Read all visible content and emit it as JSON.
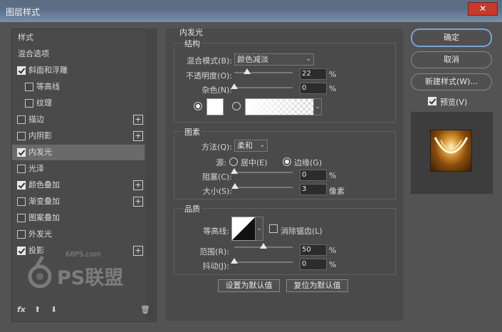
{
  "window": {
    "title": "图层样式",
    "close_icon": "close-icon"
  },
  "sidebar": {
    "items": [
      {
        "label": "样式",
        "checkbox": false,
        "checked": false,
        "plus": false,
        "selected": false,
        "indent": false
      },
      {
        "label": "混合选项",
        "checkbox": false,
        "checked": false,
        "plus": false,
        "selected": false,
        "indent": false
      },
      {
        "label": "斜面和浮雕",
        "checkbox": true,
        "checked": true,
        "plus": false,
        "selected": false,
        "indent": false
      },
      {
        "label": "等高线",
        "checkbox": true,
        "checked": false,
        "plus": false,
        "selected": false,
        "indent": true
      },
      {
        "label": "纹理",
        "checkbox": true,
        "checked": false,
        "plus": false,
        "selected": false,
        "indent": true
      },
      {
        "label": "描边",
        "checkbox": true,
        "checked": false,
        "plus": true,
        "selected": false,
        "indent": false
      },
      {
        "label": "内阴影",
        "checkbox": true,
        "checked": false,
        "plus": true,
        "selected": false,
        "indent": false
      },
      {
        "label": "内发光",
        "checkbox": true,
        "checked": true,
        "plus": false,
        "selected": true,
        "indent": false
      },
      {
        "label": "光泽",
        "checkbox": true,
        "checked": false,
        "plus": false,
        "selected": false,
        "indent": false
      },
      {
        "label": "颜色叠加",
        "checkbox": true,
        "checked": true,
        "plus": true,
        "selected": false,
        "indent": false
      },
      {
        "label": "渐变叠加",
        "checkbox": true,
        "checked": false,
        "plus": true,
        "selected": false,
        "indent": false
      },
      {
        "label": "图案叠加",
        "checkbox": true,
        "checked": false,
        "plus": false,
        "selected": false,
        "indent": false
      },
      {
        "label": "外发光",
        "checkbox": true,
        "checked": false,
        "plus": false,
        "selected": false,
        "indent": false
      },
      {
        "label": "投影",
        "checkbox": true,
        "checked": true,
        "plus": true,
        "selected": false,
        "indent": false
      }
    ],
    "bottom": {
      "fx": "fx",
      "up": "⬆",
      "down": "⬇",
      "trash": "🗑"
    },
    "watermark": {
      "site": "68PS.com",
      "brand": "PS联盟"
    }
  },
  "inner_glow": {
    "title": "内发光",
    "structure": {
      "title": "结构",
      "blend_mode_label": "混合模式(B):",
      "blend_mode_value": "颜色减淡",
      "opacity_label": "不透明度(O):",
      "opacity_value": "22",
      "opacity_unit": "%",
      "opacity_level": 0.22,
      "noise_label": "杂色(N):",
      "noise_value": "0",
      "noise_unit": "%",
      "noise_level": 0
    },
    "elements": {
      "title": "图素",
      "method_label": "方法(Q):",
      "method_value": "柔和",
      "source_label": "源:",
      "center_label": "居中(E)",
      "edge_label": "边缘(G)",
      "choke_label": "阻塞(C):",
      "choke_value": "0",
      "choke_unit": "%",
      "choke_level": 0,
      "size_label": "大小(S):",
      "size_value": "3",
      "size_unit": "像素",
      "size_level": 0.012
    },
    "quality": {
      "title": "品质",
      "contour_label": "等高线:",
      "antialias_label": "消除锯齿(L)",
      "range_label": "范围(R):",
      "range_value": "50",
      "range_unit": "%",
      "range_level": 0.5,
      "jitter_label": "抖动(J):",
      "jitter_value": "0",
      "jitter_unit": "%",
      "jitter_level": 0
    },
    "set_default": "设置为默认值",
    "reset_default": "复位为默认值"
  },
  "actions": {
    "ok": "确定",
    "cancel": "取消",
    "new_style": "新建样式(W)...",
    "preview_label": "预览(V)",
    "preview_checked": true
  }
}
